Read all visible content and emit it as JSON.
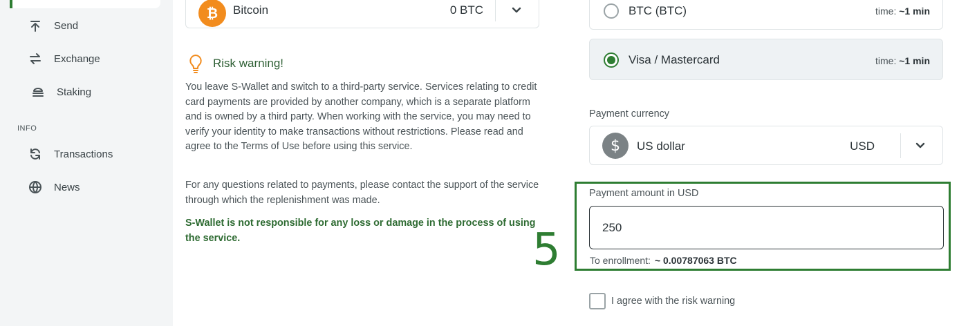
{
  "sidebar": {
    "items": [
      {
        "label": "Send",
        "icon": "upload-icon"
      },
      {
        "label": "Exchange",
        "icon": "exchange-icon"
      },
      {
        "label": "Staking",
        "icon": "staking-icon"
      }
    ],
    "info_title": "INFO",
    "info_items": [
      {
        "label": "Transactions",
        "icon": "refresh-icon"
      },
      {
        "label": "News",
        "icon": "globe-icon"
      }
    ]
  },
  "coin": {
    "name": "Bitcoin",
    "amount": "0 BTC",
    "symbol": "₿"
  },
  "risk": {
    "title": "Risk warning!",
    "p1": "You leave S-Wallet and switch to a third-party service. Services relating to credit card payments are provided by another company, which is a separate platform and is owned by a third party. When working with the service, you may need to verify your identity to make transactions without restrictions. Please read and agree to the Terms of Use before using this service.",
    "p2": "For any questions related to payments, please contact the support of the service through which the replenishment was made.",
    "p3": "S-Wallet is not responsible for any loss or damage in the process of using the service."
  },
  "step_number": "5",
  "methods": [
    {
      "label": "BTC (BTC)",
      "time_label": "time:",
      "time_value": "~1 min",
      "selected": false
    },
    {
      "label": "Visa / Mastercard",
      "time_label": "time:",
      "time_value": "~1 min",
      "selected": true
    }
  ],
  "payment_currency": {
    "label": "Payment currency",
    "name": "US dollar",
    "code": "USD",
    "symbol": "$"
  },
  "amount": {
    "label": "Payment amount in USD",
    "value": "250"
  },
  "enrollment": {
    "label": "To enrollment:",
    "value": "~ 0.00787063 BTC"
  },
  "agree": {
    "label": "I agree with the risk warning",
    "checked": false
  },
  "colors": {
    "accent": "#2e7d32",
    "bitcoin": "#f28c1e",
    "warning_icon": "#f28c1e"
  }
}
